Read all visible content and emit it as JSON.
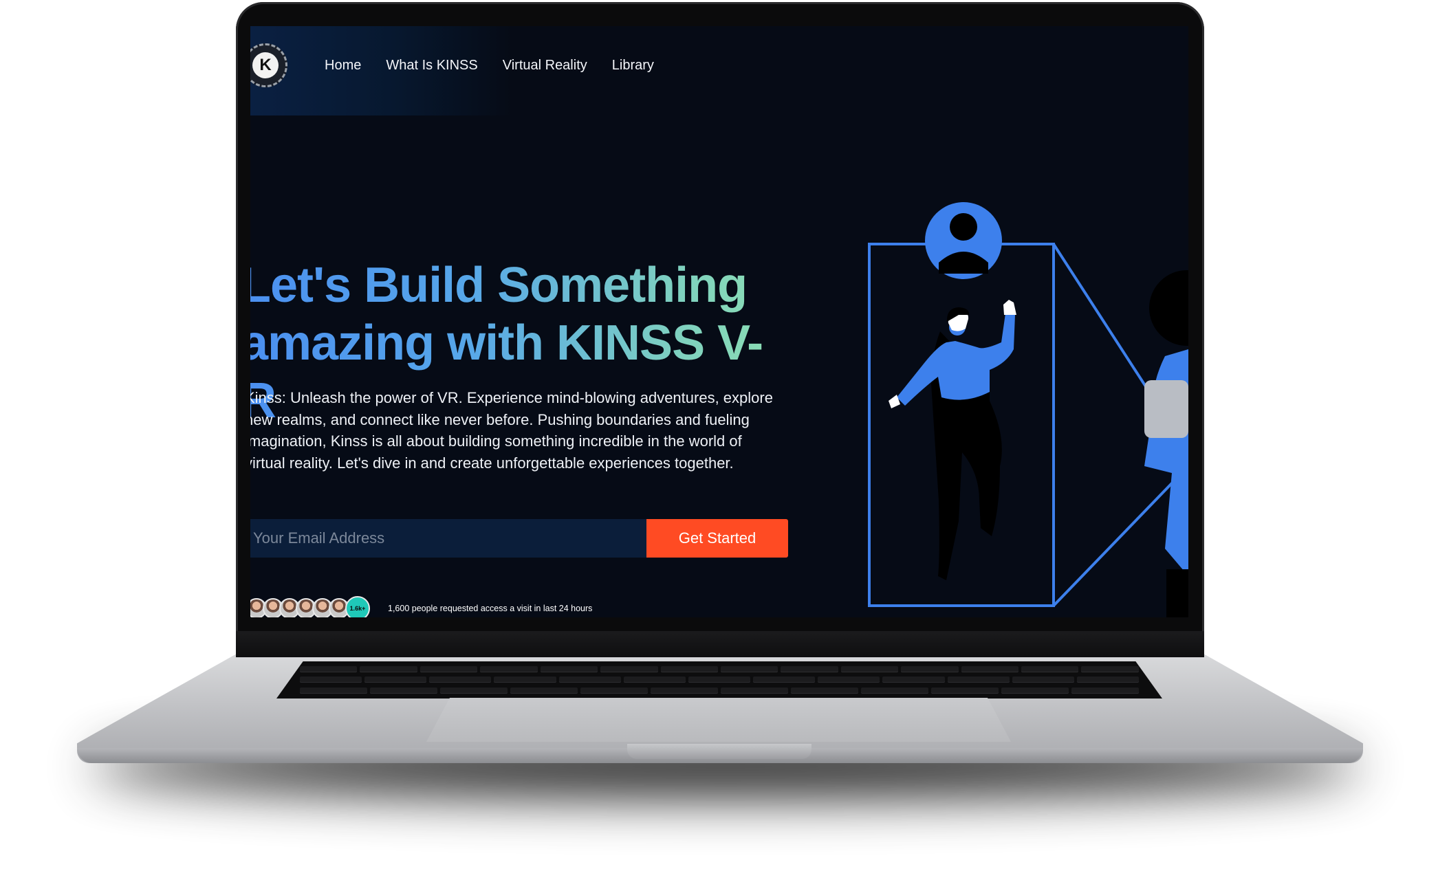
{
  "nav": {
    "logo_letter": "K",
    "links": [
      "Home",
      "What Is KINSS",
      "Virtual Reality",
      "Library"
    ]
  },
  "hero": {
    "title_line1": "Let's Build Something",
    "title_line2": "amazing with KINSS V-R",
    "description": "Kinss: Unleash the power of VR. Experience mind-blowing adventures, explore new realms, and connect like never before. Pushing boundaries and fueling imagination, Kinss is all about building something incredible in the world of virtual reality. Let's dive in and create unforgettable experiences together.",
    "email_placeholder": "Your Email Address",
    "cta_label": "Get Started",
    "avatar_count_badge": "1.6k+",
    "social_proof": "1,600 people requested access a visit in last 24 hours"
  },
  "colors": {
    "background": "#060b16",
    "accent": "#ff4b23",
    "illustration_blue": "#3d80ec",
    "input_bg": "#0b1e3a",
    "badge": "#1fc9b8"
  },
  "icons": {
    "logo": "k-gear-logo-icon",
    "illustration": "vr-user-illustration"
  }
}
